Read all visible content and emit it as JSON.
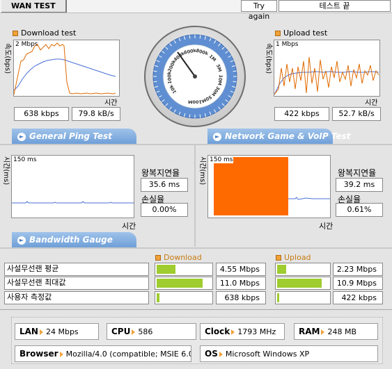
{
  "header": {
    "title": "WAN TEST",
    "try_again": "Try again",
    "end_test": "테스트 끝"
  },
  "download": {
    "title": "Download test",
    "yaxis": "속도(bps)",
    "scale": "2 Mbps",
    "xaxis": "시간",
    "kbps": "638 kbps",
    "kBs": "79.8 kB/s"
  },
  "upload": {
    "title": "Upload test",
    "yaxis": "속도(bps)",
    "scale": "1 Mbps",
    "xaxis": "시간",
    "kbps": "422 kbps",
    "kBs": "52.7 kB/s"
  },
  "gauge": {
    "ticks": [
      "10k",
      "100k",
      "200k",
      "400k",
      "600k",
      "800k",
      "1M",
      "5M",
      "10M",
      "30M",
      "50M",
      "100M"
    ]
  },
  "sections": {
    "ping": "General Ping Test",
    "game": "Network Game & VoIP Test",
    "bandwidth": "Bandwidth Gauge"
  },
  "ping": {
    "yaxis": "시간(ms)",
    "scale": "150 ms",
    "xaxis": "시간",
    "rtt_label": "왕복지연율",
    "rtt": "35.6 ms",
    "loss_label": "손실율",
    "loss": "0.00%"
  },
  "game": {
    "yaxis": "시간(ms)",
    "scale": "150 ms",
    "xaxis": "시간",
    "rtt_label": "왕복지연율",
    "rtt": "39.2 ms",
    "loss_label": "손실율",
    "loss": "0.61%"
  },
  "bandwidth": {
    "download_header": "Download",
    "upload_header": "Upload",
    "rows": [
      {
        "label": "사설무선랜 평균",
        "down": "4.55 Mbps",
        "down_fill": 0.41,
        "up": "2.23 Mbps",
        "up_fill": 0.2
      },
      {
        "label": "사설무선랜 최대값",
        "down": "11.0 Mbps",
        "down_fill": 1.0,
        "up": "10.9 Mbps",
        "up_fill": 1.0
      },
      {
        "label": "사용자 측정값",
        "down": "638 kbps",
        "down_fill": 0.06,
        "up": "422 kbps",
        "up_fill": 0.04
      }
    ]
  },
  "system": {
    "lan_label": "LAN",
    "lan": "24 Mbps",
    "cpu_label": "CPU",
    "cpu": "586",
    "clock_label": "Clock",
    "clock": "1793 MHz",
    "ram_label": "RAM",
    "ram": "248 MB",
    "browser_label": "Browser",
    "browser": "Mozilla/4.0 (compatible; MSIE 6.0",
    "os_label": "OS",
    "os": "Microsoft Windows XP"
  },
  "colors": {
    "accent_orange": "#f0a23a",
    "bar_green": "#9fcc2f",
    "line_blue": "#4a6fd6",
    "pill_blue": "#6f9fd8",
    "ping_fill": "#ff6a00"
  }
}
